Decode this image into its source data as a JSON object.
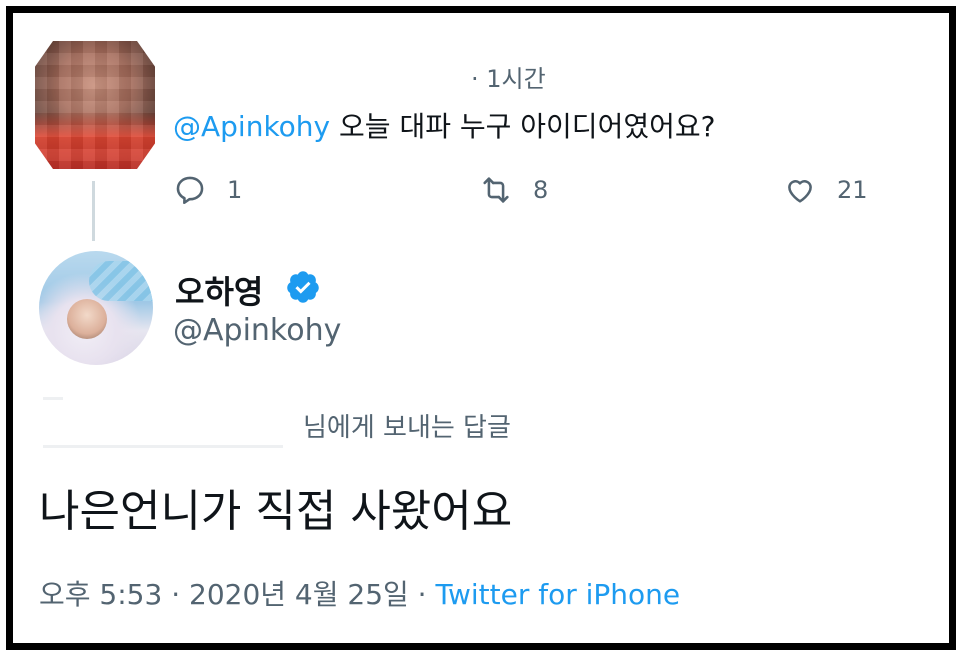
{
  "reply": {
    "time_ago": "· 1시간",
    "mention": "@Apinkohy",
    "text": " 오늘 대파 누구 아이디어였어요?",
    "reply_count": "1",
    "retweet_count": "8",
    "like_count": "21"
  },
  "tweet": {
    "display_name": "오하영",
    "handle": "@Apinkohy",
    "reply_to_label": "님에게 보내는 답글",
    "text": "나은언니가 직접 사왔어요",
    "timestamp": "오후 5:53 · 2020년 4월 25일 · ",
    "source": "Twitter for iPhone"
  },
  "colors": {
    "accent": "#1d9bf0",
    "muted": "#536471",
    "text": "#0f1419"
  },
  "icons": {
    "reply": "reply-icon",
    "retweet": "retweet-icon",
    "like": "heart-icon",
    "verified": "verified-badge-icon"
  }
}
